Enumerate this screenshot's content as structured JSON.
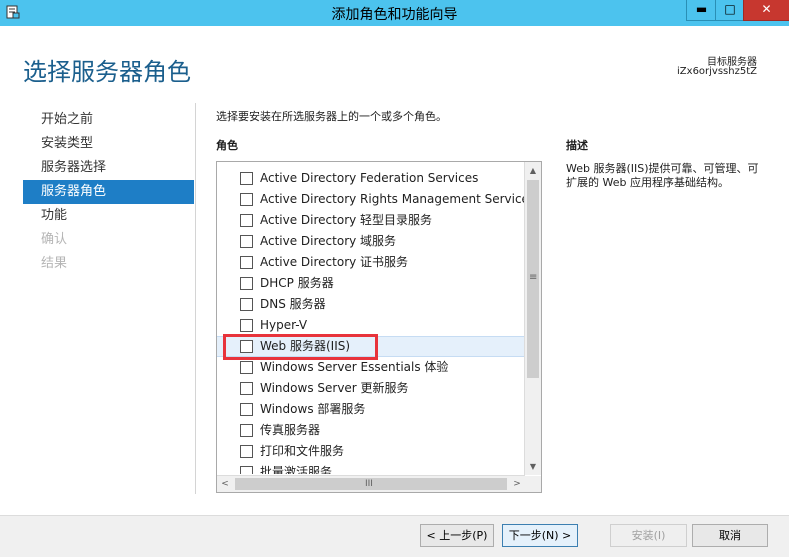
{
  "window": {
    "title": "添加角色和功能向导",
    "min_glyph": "▬",
    "max_glyph": "□",
    "close_glyph": "✕"
  },
  "header": {
    "title": "选择服务器角色",
    "target_label": "目标服务器",
    "target_value": "iZx6orjvsshz5tZ"
  },
  "nav": {
    "items": [
      {
        "label": "开始之前",
        "state": "normal"
      },
      {
        "label": "安装类型",
        "state": "normal"
      },
      {
        "label": "服务器选择",
        "state": "normal"
      },
      {
        "label": "服务器角色",
        "state": "active"
      },
      {
        "label": "功能",
        "state": "normal"
      },
      {
        "label": "确认",
        "state": "disabled"
      },
      {
        "label": "结果",
        "state": "disabled"
      }
    ]
  },
  "main": {
    "instruction": "选择要安装在所选服务器上的一个或多个角色。",
    "roles_header": "角色",
    "roles": [
      {
        "label": "Active Directory Federation Services",
        "checked": false,
        "selected": false
      },
      {
        "label": "Active Directory Rights Management Services",
        "checked": false,
        "selected": false
      },
      {
        "label": "Active Directory 轻型目录服务",
        "checked": false,
        "selected": false
      },
      {
        "label": "Active Directory 域服务",
        "checked": false,
        "selected": false
      },
      {
        "label": "Active Directory 证书服务",
        "checked": false,
        "selected": false
      },
      {
        "label": "DHCP 服务器",
        "checked": false,
        "selected": false
      },
      {
        "label": "DNS 服务器",
        "checked": false,
        "selected": false
      },
      {
        "label": "Hyper-V",
        "checked": false,
        "selected": false
      },
      {
        "label": "Web 服务器(IIS)",
        "checked": false,
        "selected": true
      },
      {
        "label": "Windows Server Essentials 体验",
        "checked": false,
        "selected": false
      },
      {
        "label": "Windows Server 更新服务",
        "checked": false,
        "selected": false
      },
      {
        "label": "Windows 部署服务",
        "checked": false,
        "selected": false
      },
      {
        "label": "传真服务器",
        "checked": false,
        "selected": false
      },
      {
        "label": "打印和文件服务",
        "checked": false,
        "selected": false
      },
      {
        "label": "批量激活服务",
        "checked": false,
        "selected": false
      }
    ],
    "scroll": {
      "up": "▲",
      "down": "▼",
      "left": "<",
      "right": ">",
      "vgrip": "≡",
      "hgrip": "III"
    }
  },
  "description": {
    "header": "描述",
    "text": "Web 服务器(IIS)提供可靠、可管理、可扩展的 Web 应用程序基础结构。"
  },
  "buttons": {
    "prev": "< 上一步(P)",
    "next": "下一步(N) >",
    "install": "安装(I)",
    "cancel": "取消"
  },
  "colors": {
    "titlebar": "#4cc3ee",
    "nav_active": "#1e7ec6",
    "title_text": "#1b5f8d",
    "highlight": "#e8333b"
  }
}
